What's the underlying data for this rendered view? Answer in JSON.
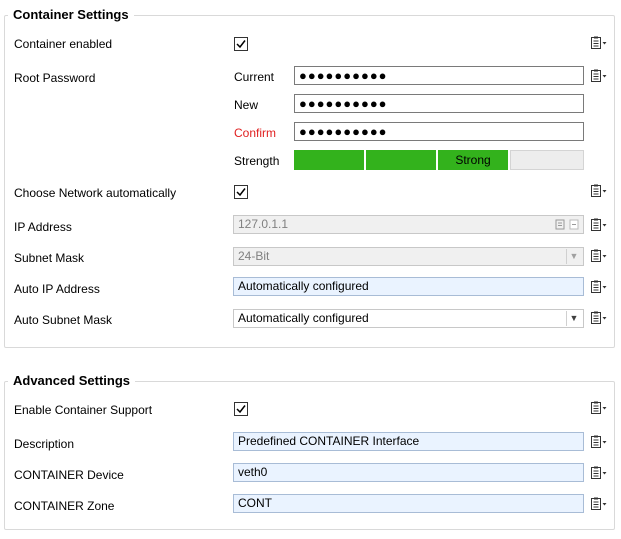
{
  "container": {
    "title": "Container Settings",
    "enabled_label": "Container enabled",
    "enabled": true,
    "root_password_label": "Root Password",
    "password": {
      "current_label": "Current",
      "new_label": "New",
      "confirm_label": "Confirm",
      "strength_label": "Strength",
      "current_value": "●●●●●●●●●●",
      "new_value": "●●●●●●●●●●",
      "confirm_value": "●●●●●●●●●●",
      "strength_text": "Strong",
      "strength_level": 0.75
    },
    "network_auto_label": "Choose Network automatically",
    "network_auto": true,
    "ip_label": "IP Address",
    "ip_value": "127.0.1.1",
    "subnet_label": "Subnet Mask",
    "subnet_value": "24-Bit",
    "auto_ip_label": "Auto IP Address",
    "auto_ip_value": "Automatically configured",
    "auto_subnet_label": "Auto Subnet Mask",
    "auto_subnet_value": "Automatically configured"
  },
  "advanced": {
    "title": "Advanced Settings",
    "enable_support_label": "Enable Container Support",
    "enable_support": true,
    "description_label": "Description",
    "description_value": "Predefined CONTAINER Interface",
    "device_label": "CONTAINER Device",
    "device_value": "veth0",
    "zone_label": "CONTAINER Zone",
    "zone_value": "CONT"
  },
  "colors": {
    "strength_on": "#33b21c",
    "confirm_label": "#e02020",
    "auto_field_bg": "#eaf3ff"
  },
  "icons": {
    "row_menu": "clipboard-menu-icon",
    "checkmark": "checkmark-icon",
    "dropdown": "chevron-down-icon"
  }
}
